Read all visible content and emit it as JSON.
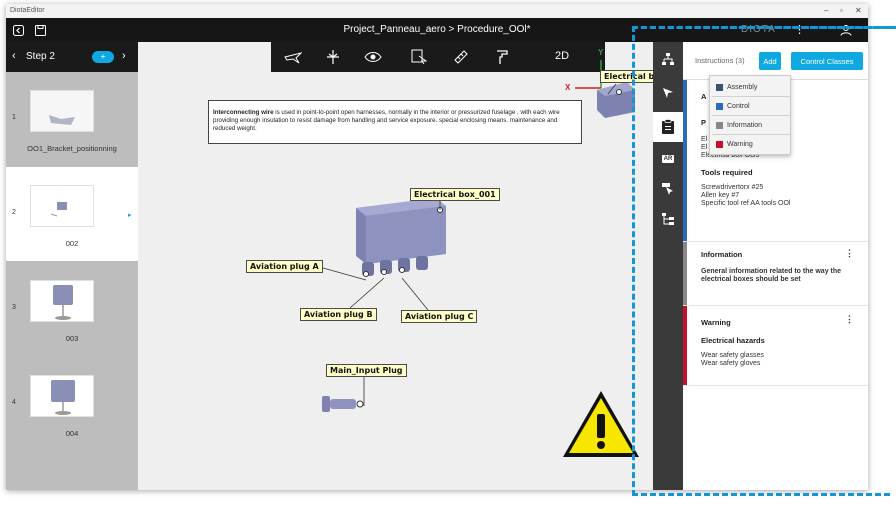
{
  "window": {
    "app_name": "DiotaEditor",
    "controls": {
      "minimize": "–",
      "maximize": "▫",
      "close": "✕"
    }
  },
  "header": {
    "title": "Project_Panneau_aero > Procedure_OOl*",
    "brand": "DIOTA",
    "menu_icon": "⋮"
  },
  "stepbar": {
    "label": "Step 2",
    "add_label": "+"
  },
  "slides": [
    {
      "number": "1",
      "label": "OO1_Bracket_positionning"
    },
    {
      "number": "2",
      "label": "002"
    },
    {
      "number": "3",
      "label": "003"
    },
    {
      "number": "4",
      "label": "004"
    }
  ],
  "toolbar": {
    "mode_2d": "2D",
    "tools": [
      "plane-icon",
      "gizmo-icon",
      "eye-icon",
      "cursor-icon",
      "ruler-icon",
      "paint-roller-icon"
    ]
  },
  "viewport": {
    "info_text_bold": "Interconnecting wire",
    "info_text_rest": " is used in point-to-point open harnesses, normally in the interior or pressurized fuselage , with each wire providing enough insulation to resist damage from handling and service exposure. special enclosing means. maintenance and reduced weight.",
    "axis_y": "Y",
    "axis_x": "X",
    "callouts": {
      "electrical_box_top": "Electrical box",
      "electrical_box_001": "Electrical box_001",
      "aviation_plug_a": "Aviation plug A",
      "aviation_plug_b": "Aviation plug B",
      "aviation_plug_c": "Aviation plug C",
      "main_input_plug": "Main_Input Plug"
    }
  },
  "right_panel": {
    "tab_instructions": "Instructions (3)",
    "add_button": "Add",
    "control_classes_button": "Control Classes",
    "partial_label_a": "A",
    "partial_label_p": "P",
    "partial_lines": [
      "El",
      "El",
      "Electrical box OO3"
    ],
    "tools_heading": "Tools required",
    "tools_lines": [
      "Screwdrivertorx #25",
      "Allen key #7",
      "Specific tool ref AA tools OOl"
    ],
    "info_card": {
      "title": "Information",
      "text": "General information related to the way the electrical boxes should be set"
    },
    "warning_card": {
      "title": "Warning",
      "subtitle": "Electrical hazards",
      "lines": [
        "Wear safety glasses",
        "Wear safety gloves"
      ]
    }
  },
  "dropdown": {
    "items": [
      {
        "label": "Assembly",
        "color": "#3d4f73"
      },
      {
        "label": "Control",
        "color": "#2b6bb8"
      },
      {
        "label": "Information",
        "color": "#888888"
      },
      {
        "label": "Warning",
        "color": "#c8102e"
      }
    ]
  },
  "colors": {
    "accent_blue": "#10a8e0",
    "warning_red": "#c8102e",
    "info_grey": "#888888",
    "highlight_dashed": "#1296d8",
    "callout_fill": "#fefec6"
  }
}
